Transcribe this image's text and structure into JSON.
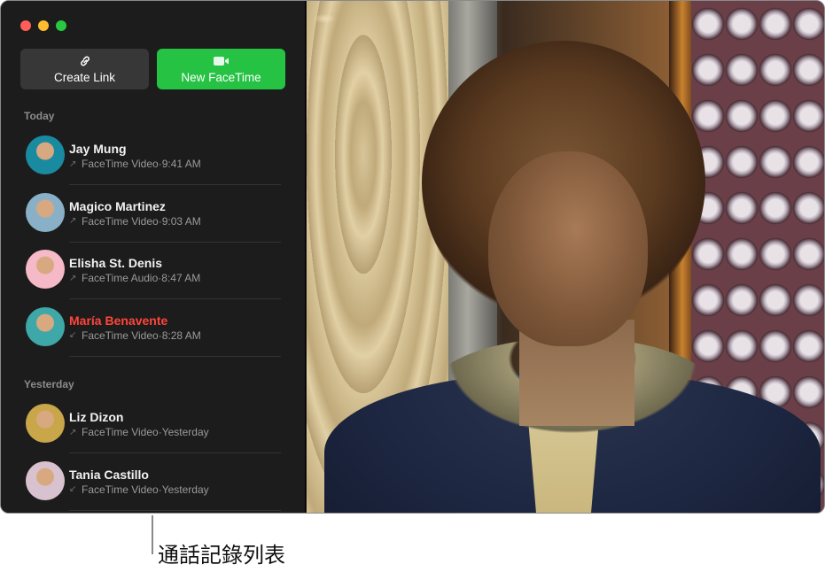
{
  "window": {
    "traffic_lights": [
      "close",
      "minimize",
      "zoom"
    ]
  },
  "toolbar": {
    "create_link": {
      "label": "Create Link",
      "icon": "link-icon"
    },
    "new_facetime": {
      "label": "New FaceTime",
      "icon": "video-camera-icon"
    }
  },
  "sections": [
    {
      "label": "Today",
      "calls": [
        {
          "name": "Jay Mung",
          "direction": "outgoing",
          "type": "FaceTime Video",
          "time": "9:41 AM",
          "missed": false,
          "avatar_color": "#1a8aa0"
        },
        {
          "name": "Magico Martinez",
          "direction": "outgoing",
          "type": "FaceTime Video",
          "time": "9:03 AM",
          "missed": false,
          "avatar_color": "#8ab0c8"
        },
        {
          "name": "Elisha St. Denis",
          "direction": "outgoing",
          "type": "FaceTime Audio",
          "time": "8:47 AM",
          "missed": false,
          "avatar_color": "#f6b9c8"
        },
        {
          "name": "María Benavente",
          "direction": "incoming",
          "type": "FaceTime Video",
          "time": "8:28 AM",
          "missed": true,
          "avatar_color": "#3ea8a8"
        }
      ]
    },
    {
      "label": "Yesterday",
      "calls": [
        {
          "name": "Liz Dizon",
          "direction": "outgoing",
          "type": "FaceTime Video",
          "time": "Yesterday",
          "missed": false,
          "avatar_color": "#c9a64a"
        },
        {
          "name": "Tania Castillo",
          "direction": "incoming",
          "type": "FaceTime Video",
          "time": "Yesterday",
          "missed": false,
          "avatar_color": "#d9c2cf"
        }
      ]
    }
  ],
  "colors": {
    "accent_green": "#25c244",
    "missed_red": "#ff453a"
  },
  "video": {
    "description": "Video preview of person with curly hair"
  },
  "callout": {
    "label": "通話記錄列表"
  }
}
